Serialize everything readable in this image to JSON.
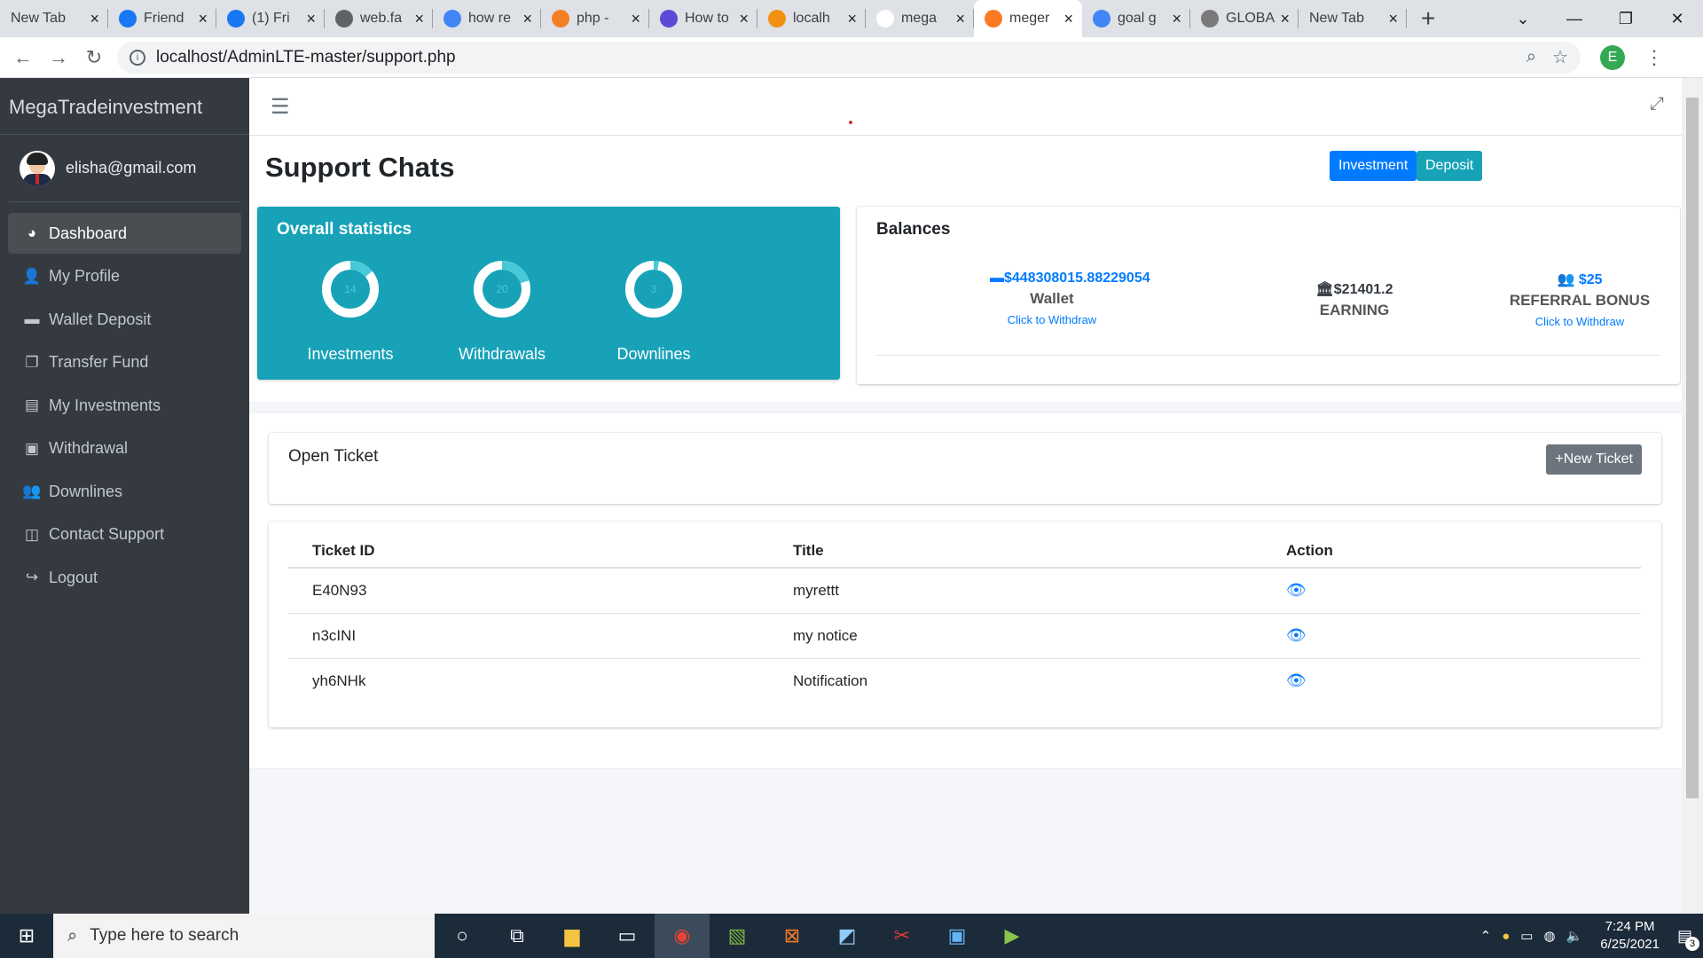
{
  "browser": {
    "tabs": [
      {
        "title": "New Tab",
        "favicon": "none-icon",
        "color": "#dee1e6"
      },
      {
        "title": "Friend",
        "favicon": "facebook-icon",
        "color": "#1877f2"
      },
      {
        "title": "(1) Fri",
        "favicon": "facebook-icon",
        "color": "#1877f2"
      },
      {
        "title": "web.fa",
        "favicon": "facebook-icon",
        "color": "#5f6368"
      },
      {
        "title": "how re",
        "favicon": "google-icon",
        "color": "#4285f4"
      },
      {
        "title": "php - ",
        "favicon": "stackoverflow-icon",
        "color": "#f48024"
      },
      {
        "title": "How to",
        "favicon": "k-icon",
        "color": "#5b4ad6"
      },
      {
        "title": "localh",
        "favicon": "phpmyadmin-icon",
        "color": "#f29111"
      },
      {
        "title": "mega",
        "favicon": "b-icon",
        "color": "#ffffff"
      },
      {
        "title": "meger",
        "favicon": "xampp-icon",
        "color": "#fb7a24"
      },
      {
        "title": "goal g",
        "favicon": "google-icon",
        "color": "#4285f4"
      },
      {
        "title": "GLOBA",
        "favicon": "globe-icon",
        "color": "#7a7a7a"
      },
      {
        "title": "New Tab",
        "favicon": "none-icon",
        "color": "#dee1e6"
      }
    ],
    "url": "localhost/AdminLTE-master/support.php",
    "profile_initial": "E"
  },
  "sidebar": {
    "brand": "MegaTradeinvestment",
    "user_email": "elisha@gmail.com",
    "items": [
      {
        "label": "Dashboard",
        "icon": "tachometer-icon",
        "glyph": "◕"
      },
      {
        "label": "My Profile",
        "icon": "user-icon",
        "glyph": "👤"
      },
      {
        "label": "Wallet Deposit",
        "icon": "wallet-icon",
        "glyph": "▬"
      },
      {
        "label": "Transfer Fund",
        "icon": "copy-icon",
        "glyph": "❐"
      },
      {
        "label": "My Investments",
        "icon": "briefcase-icon",
        "glyph": "▤"
      },
      {
        "label": "Withdrawal",
        "icon": "money-icon",
        "glyph": "▣"
      },
      {
        "label": "Downlines",
        "icon": "users-icon",
        "glyph": "👥"
      },
      {
        "label": "Contact Support",
        "icon": "columns-icon",
        "glyph": "◫"
      },
      {
        "label": "Logout",
        "icon": "sign-out-icon",
        "glyph": "↪"
      }
    ]
  },
  "page": {
    "title": "Support Chats",
    "btn_investment": "Investment",
    "btn_deposit": "Deposit"
  },
  "stats": {
    "title": "Overall statistics",
    "knobs": [
      {
        "label": "Investments",
        "value": "14",
        "fill": 0.14
      },
      {
        "label": "Withdrawals",
        "value": "20",
        "fill": 0.2
      },
      {
        "label": "Downlines",
        "value": "3",
        "fill": 0.03
      }
    ]
  },
  "balances": {
    "title": "Balances",
    "wallet_amount": "$448308015.88229054",
    "wallet_label": "Wallet",
    "wallet_link": "Click to Withdraw",
    "earning_amount": "$21401.2",
    "earning_label": "EARNING",
    "referral_amount": "$25",
    "referral_label": "REFERRAL BONUS",
    "referral_link": "Click to Withdraw"
  },
  "tickets": {
    "open_title": "Open Ticket",
    "new_button": "+New Ticket",
    "headers": [
      "Ticket ID",
      "Title",
      "Action"
    ],
    "rows": [
      {
        "id": "E40N93",
        "title": "myrettt"
      },
      {
        "id": "n3cINI",
        "title": "my notice"
      },
      {
        "id": "yh6NHk",
        "title": "Notification"
      }
    ]
  },
  "taskbar": {
    "search_placeholder": "Type here to search",
    "time": "7:24 PM",
    "date": "6/25/2021",
    "notifications": "3"
  },
  "colors": {
    "sidebar": "#343a40",
    "primary": "#007bff",
    "info": "#17a2b8",
    "secondary": "#6c757d"
  }
}
